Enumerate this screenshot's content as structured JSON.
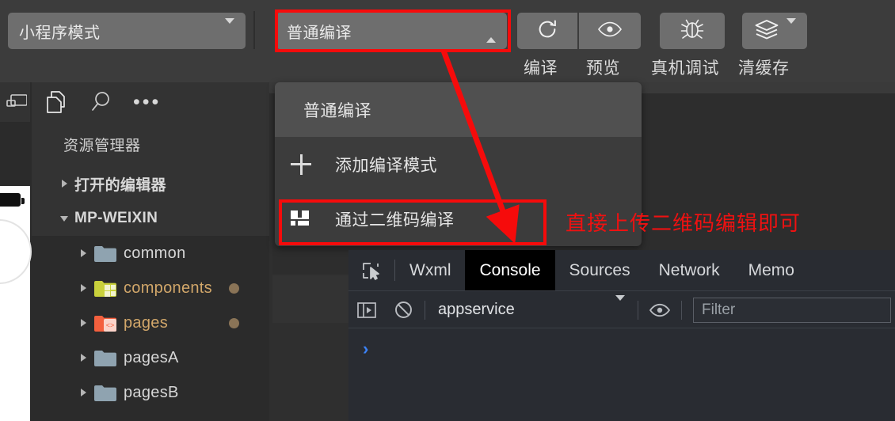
{
  "toolbar": {
    "mode_selector": {
      "label": "小程序模式",
      "icon": "chevron-down-icon"
    },
    "compile_selector": {
      "label": "普通编译",
      "icon": "chevron-up-icon"
    },
    "buttons": [
      {
        "name": "compile",
        "label": "编译",
        "icon": "refresh-icon"
      },
      {
        "name": "preview",
        "label": "预览",
        "icon": "eye-icon"
      },
      {
        "name": "real-device-debug",
        "label": "真机调试",
        "icon": "bug-icon"
      },
      {
        "name": "clear-cache",
        "label": "清缓存",
        "icon": "layers-icon"
      }
    ]
  },
  "dropdown_menu": {
    "items": [
      {
        "label": "普通编译",
        "icon": null,
        "selected": true
      },
      {
        "label": "添加编译模式",
        "icon": "plus-icon",
        "selected": false
      },
      {
        "label": "通过二维码编译",
        "icon": "qrcode-icon",
        "selected": false
      }
    ]
  },
  "sidebar": {
    "icons": [
      "copy-files-icon",
      "search-icon",
      "more-icon"
    ],
    "title": "资源管理器",
    "sections": [
      {
        "label": "打开的编辑器",
        "expanded": false
      },
      {
        "label": "MP-WEIXIN",
        "expanded": true
      }
    ],
    "files": [
      {
        "label": "common",
        "folder_color": "#8fa3b0",
        "modified": false,
        "badge": false
      },
      {
        "label": "components",
        "folder_color": "#c9d13c",
        "modified": true,
        "badge": true
      },
      {
        "label": "pages",
        "folder_color": "#f4603e",
        "modified": true,
        "badge": true
      },
      {
        "label": "pagesA",
        "folder_color": "#8fa3b0",
        "modified": false,
        "badge": false
      },
      {
        "label": "pagesB",
        "folder_color": "#8fa3b0",
        "modified": false,
        "badge": false
      }
    ]
  },
  "devtools": {
    "inspect_icon": "cursor-select-icon",
    "tabs": [
      {
        "label": "Wxml",
        "active": false
      },
      {
        "label": "Console",
        "active": true
      },
      {
        "label": "Sources",
        "active": false
      },
      {
        "label": "Network",
        "active": false
      },
      {
        "label": "Memo",
        "active": false
      }
    ],
    "console_toolbar": {
      "sidebar_toggle_icon": "panel-toggle-icon",
      "clear_icon": "clear-console-icon",
      "context": "appservice",
      "context_caret": "chevron-down-icon",
      "eye_icon": "eye-icon",
      "filter_placeholder": "Filter",
      "filter_value": "Filter"
    },
    "prompt": "›"
  },
  "annotations": {
    "text": "直接上传二维码编辑即可",
    "color": "#ef1111",
    "highlights": [
      "compile-selector",
      "qrcode-compile-menu-item"
    ],
    "arrow": {
      "from": "compile-selector",
      "to": "qrcode-compile-menu-item"
    }
  },
  "colors": {
    "toolbar_bg": "#3c3c3c",
    "button_bg": "#6e6e6e",
    "sidebar_bg": "#2b2b2b",
    "menu_bg": "#3c3c3c",
    "menu_selected_bg": "#505050",
    "devtools_bg": "#292c32",
    "active_tab_bg": "#000000",
    "annotation_red": "#f60b0b",
    "prompt_blue": "#3b82f6",
    "modified_text": "#d2a76a"
  }
}
